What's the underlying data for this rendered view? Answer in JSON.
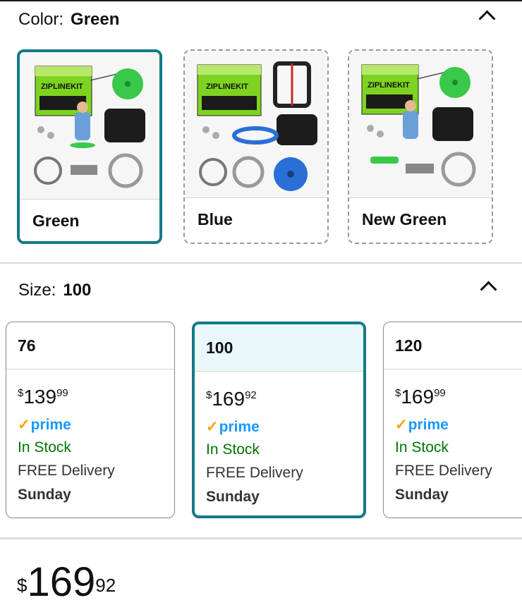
{
  "color_section": {
    "label": "Color:",
    "selected": "Green",
    "swatches": [
      {
        "name": "Green",
        "box_title": "ZIPLINEKIT",
        "selected": true
      },
      {
        "name": "Blue",
        "box_title": "ZIPLINEKIT",
        "selected": false
      },
      {
        "name": "New Green",
        "box_title": "ZIPLINEKIT",
        "selected": false
      }
    ]
  },
  "size_section": {
    "label": "Size:",
    "selected": "100",
    "options": [
      {
        "size": "76",
        "price_currency": "$",
        "price_whole": "139",
        "price_fraction": "99",
        "prime": "prime",
        "stock": "In Stock",
        "delivery": "FREE Delivery",
        "day": "Sunday",
        "selected": false
      },
      {
        "size": "100",
        "price_currency": "$",
        "price_whole": "169",
        "price_fraction": "92",
        "prime": "prime",
        "stock": "In Stock",
        "delivery": "FREE Delivery",
        "day": "Sunday",
        "selected": true
      },
      {
        "size": "120",
        "price_currency": "$",
        "price_whole": "169",
        "price_fraction": "99",
        "prime": "prime",
        "stock": "In Stock",
        "delivery": "FREE Delivery",
        "day": "Sunday",
        "selected": false
      }
    ]
  },
  "price": {
    "currency": "$",
    "whole": "169",
    "fraction": "92"
  },
  "colors": {
    "accent": "#137a86",
    "selected_bg": "#e8f8fb",
    "prime_blue": "#1a98ff",
    "prime_check": "#f5a000",
    "in_stock": "#007600",
    "product_green": "#7ed321",
    "product_blue": "#2a6fd6"
  },
  "icons": {
    "collapse": "chevron-up-icon",
    "prime_check": "checkmark-icon"
  }
}
